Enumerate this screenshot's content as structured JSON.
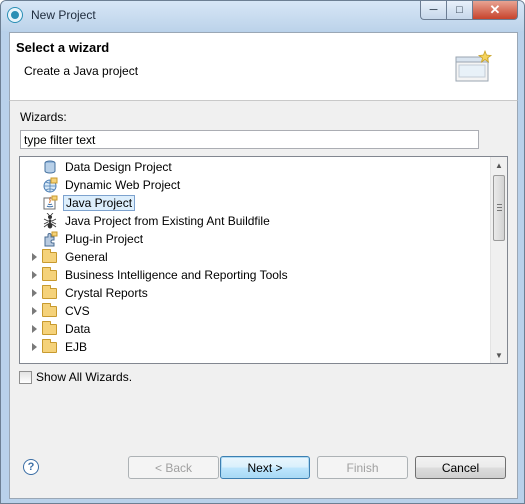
{
  "window": {
    "title": "New Project"
  },
  "header": {
    "title": "Select a wizard",
    "description": "Create a Java project"
  },
  "wizards_label": "Wizards:",
  "filter": {
    "value": "type filter text"
  },
  "tree_items": [
    {
      "label": "Data Design Project",
      "icon": "data-design-icon",
      "expandable": false,
      "selected": false
    },
    {
      "label": "Dynamic Web Project",
      "icon": "web-project-icon",
      "expandable": false,
      "selected": false
    },
    {
      "label": "Java Project",
      "icon": "java-project-icon",
      "expandable": false,
      "selected": true
    },
    {
      "label": "Java Project from Existing Ant Buildfile",
      "icon": "ant-icon",
      "expandable": false,
      "selected": false
    },
    {
      "label": "Plug-in Project",
      "icon": "plugin-icon",
      "expandable": false,
      "selected": false
    },
    {
      "label": "General",
      "icon": "folder-icon",
      "expandable": true,
      "selected": false
    },
    {
      "label": "Business Intelligence and Reporting Tools",
      "icon": "folder-icon",
      "expandable": true,
      "selected": false
    },
    {
      "label": "Crystal Reports",
      "icon": "folder-icon",
      "expandable": true,
      "selected": false
    },
    {
      "label": "CVS",
      "icon": "folder-icon",
      "expandable": true,
      "selected": false
    },
    {
      "label": "Data",
      "icon": "folder-icon",
      "expandable": true,
      "selected": false
    },
    {
      "label": "EJB",
      "icon": "folder-icon",
      "expandable": true,
      "selected": false
    }
  ],
  "show_all": {
    "label": "Show All Wizards.",
    "checked": false
  },
  "buttons": {
    "back": "< Back",
    "next": "Next >",
    "finish": "Finish",
    "cancel": "Cancel"
  },
  "help": "?"
}
